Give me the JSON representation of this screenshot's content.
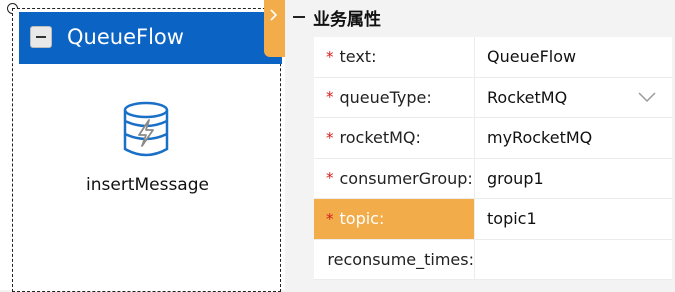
{
  "node": {
    "title": "QueueFlow",
    "label": "insertMessage",
    "icon": "database-lightning-icon",
    "header_color": "#0b63c4",
    "tab_color": "#f2ac4a"
  },
  "panel": {
    "section_title": "业务属性",
    "properties": [
      {
        "name": "text:",
        "value": "QueueFlow",
        "required": true,
        "selected": false,
        "dropdown": false
      },
      {
        "name": "queueType:",
        "value": "RocketMQ",
        "required": true,
        "selected": false,
        "dropdown": true
      },
      {
        "name": "rocketMQ:",
        "value": "myRocketMQ",
        "required": true,
        "selected": false,
        "dropdown": false
      },
      {
        "name": "consumerGroup:",
        "value": "group1",
        "required": true,
        "selected": false,
        "dropdown": false
      },
      {
        "name": "topic:",
        "value": "topic1",
        "required": true,
        "selected": true,
        "dropdown": false
      },
      {
        "name": "reconsume_times:",
        "value": "",
        "required": false,
        "selected": false,
        "dropdown": false
      }
    ],
    "required_mark": "*",
    "selected_color": "#f2ac4a"
  }
}
